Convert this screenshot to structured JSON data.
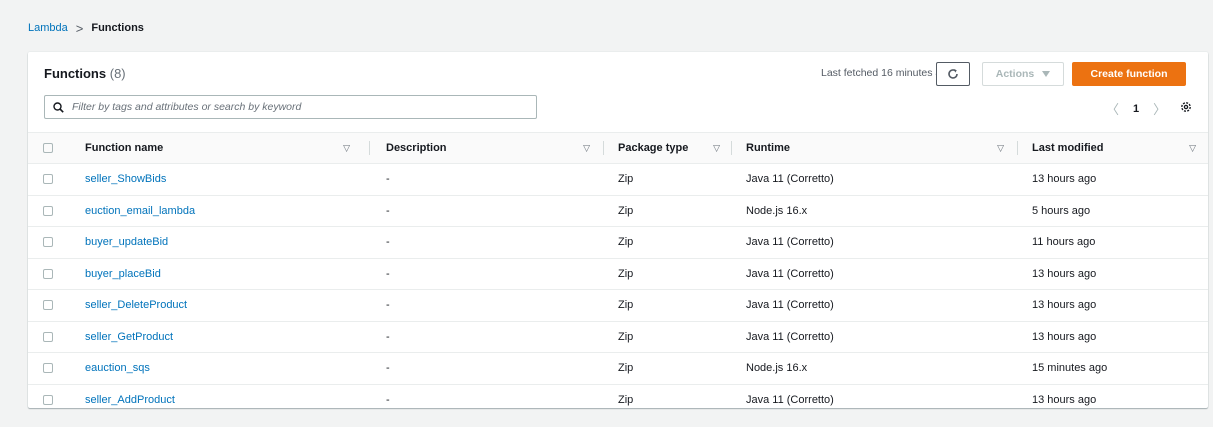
{
  "breadcrumb": {
    "root": "Lambda",
    "separator": ">",
    "current": "Functions"
  },
  "header": {
    "title": "Functions",
    "count": "(8)",
    "last_fetched": "Last fetched 16 minutes ago",
    "actions_label": "Actions",
    "create_label": "Create function"
  },
  "search": {
    "placeholder": "Filter by tags and attributes or search by keyword",
    "value": ""
  },
  "pagination": {
    "current_page": "1"
  },
  "table": {
    "columns": [
      "Function name",
      "Description",
      "Package type",
      "Runtime",
      "Last modified"
    ],
    "rows": [
      {
        "name": "seller_ShowBids",
        "description": "-",
        "package": "Zip",
        "runtime": "Java 11 (Corretto)",
        "modified": "13 hours ago"
      },
      {
        "name": "euction_email_lambda",
        "description": "-",
        "package": "Zip",
        "runtime": "Node.js 16.x",
        "modified": "5 hours ago"
      },
      {
        "name": "buyer_updateBid",
        "description": "-",
        "package": "Zip",
        "runtime": "Java 11 (Corretto)",
        "modified": "11 hours ago"
      },
      {
        "name": "buyer_placeBid",
        "description": "-",
        "package": "Zip",
        "runtime": "Java 11 (Corretto)",
        "modified": "13 hours ago"
      },
      {
        "name": "seller_DeleteProduct",
        "description": "-",
        "package": "Zip",
        "runtime": "Java 11 (Corretto)",
        "modified": "13 hours ago"
      },
      {
        "name": "seller_GetProduct",
        "description": "-",
        "package": "Zip",
        "runtime": "Java 11 (Corretto)",
        "modified": "13 hours ago"
      },
      {
        "name": "eauction_sqs",
        "description": "-",
        "package": "Zip",
        "runtime": "Node.js 16.x",
        "modified": "15 minutes ago"
      },
      {
        "name": "seller_AddProduct",
        "description": "-",
        "package": "Zip",
        "runtime": "Java 11 (Corretto)",
        "modified": "13 hours ago"
      }
    ]
  },
  "colors": {
    "link": "#0073bb",
    "primary_button": "#ec7211",
    "background": "#f2f3f3"
  }
}
